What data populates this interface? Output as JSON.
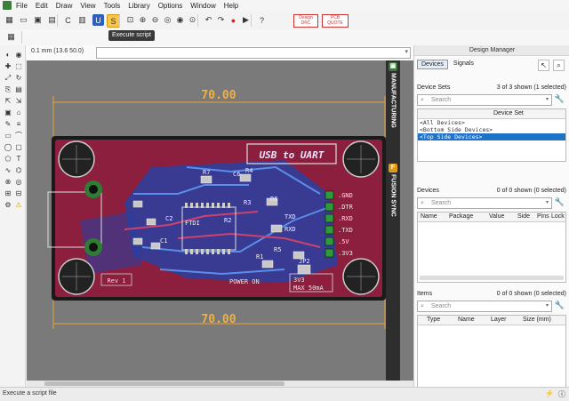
{
  "menu": [
    "File",
    "Edit",
    "Draw",
    "View",
    "Tools",
    "Library",
    "Options",
    "Window",
    "Help"
  ],
  "toolbar": {
    "tooltip": "Execute script",
    "buttons": [
      {
        "name": "grid-icon",
        "glyph": "▦"
      },
      {
        "name": "open-icon",
        "glyph": "▭"
      },
      {
        "name": "save-icon",
        "glyph": "▣"
      },
      {
        "name": "print-icon",
        "glyph": "▤"
      },
      {
        "name": "cam-icon",
        "glyph": "C"
      },
      {
        "name": "export-icon",
        "glyph": "▥"
      },
      {
        "name": "ulp-icon",
        "glyph": "U"
      },
      {
        "name": "script-icon",
        "glyph": "S"
      },
      {
        "name": "zoom-fit-icon",
        "glyph": "⊡"
      },
      {
        "name": "zoom-in-icon",
        "glyph": "⊕"
      },
      {
        "name": "zoom-out-icon",
        "glyph": "⊖"
      },
      {
        "name": "zoom-prev-icon",
        "glyph": "◎"
      },
      {
        "name": "zoom-redraw-icon",
        "glyph": "◉"
      },
      {
        "name": "zoom-area-icon",
        "glyph": "⊙"
      },
      {
        "name": "undo-icon",
        "glyph": "↶"
      },
      {
        "name": "redo-icon",
        "glyph": "↷"
      },
      {
        "name": "stop-icon",
        "glyph": "●"
      },
      {
        "name": "go-icon",
        "glyph": "▶"
      },
      {
        "name": "help-icon",
        "glyph": "?"
      }
    ],
    "badge1": "Design DRC",
    "badge2": "PCB QUOTE"
  },
  "coord": "0.1 mm (13.6 50.0)",
  "board": {
    "dim_top": "70.00",
    "dim_bottom": "70.00",
    "title": "USB to UART",
    "rev": "Rev 1",
    "power": "POWER ON",
    "volt": "3V3",
    "max": "MAX 50mA",
    "pins": [
      ".GND",
      ".DTR",
      ".RXD",
      ".TXD",
      ".5V",
      ".3V3"
    ],
    "refs": [
      "R7",
      "C6",
      "R4",
      "R6",
      "R3",
      "R5",
      "R1",
      "C2",
      "C1",
      "R2",
      "JP2"
    ],
    "hints": [
      "FTDI",
      "TXD",
      "RXD"
    ]
  },
  "sidetabs": {
    "manufacturing": "MANUFACTURING",
    "fusion": "FUSION SYNC"
  },
  "design_manager": {
    "title": "Design Manager",
    "tabs": [
      "Devices",
      "Signals"
    ],
    "device_sets": {
      "label": "Device Sets",
      "count": "3 of 3 shown (1 selected)",
      "placeholder": "Search",
      "column": "Device Set",
      "rows": [
        "<All Devices>",
        "<Bottom Side Devices>",
        "<Top Side Devices>"
      ]
    },
    "devices": {
      "label": "Devices",
      "count": "0 of 0 shown (0 selected)",
      "placeholder": "Search",
      "columns": [
        "Name",
        "Package",
        "Value",
        "Side",
        "Pins",
        "Lock"
      ]
    },
    "items": {
      "label": "Items",
      "count": "0 of 0 shown (0 selected)",
      "placeholder": "Search",
      "columns": [
        "Type",
        "Name",
        "Layer",
        "Size (mm)"
      ]
    }
  },
  "status": "Execute a script file"
}
